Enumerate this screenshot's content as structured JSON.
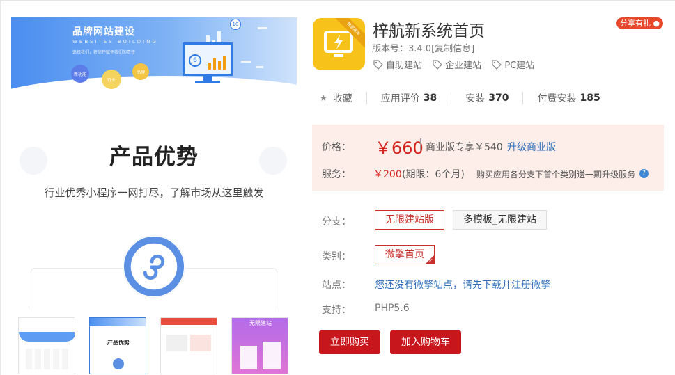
{
  "banner": {
    "title": "品牌网站建设",
    "subtitle": "WEBSITES BUILDING",
    "tagline": "选择我们，将信任赋予我们的责任",
    "bubble_1": "新功能",
    "bubble_2": "行业",
    "bubble_3": "品牌",
    "badge_number": "10",
    "screen_number": "6"
  },
  "slide": {
    "title": "产品优势",
    "subtitle": "行业优秀小程序一网打尽，了解市场从这里触发"
  },
  "thumbnails": [
    {
      "name": "thumb-1"
    },
    {
      "name": "thumb-2",
      "text": "产品优势"
    },
    {
      "name": "thumb-3"
    },
    {
      "name": "thumb-4",
      "text": "无限建站"
    }
  ],
  "app": {
    "icon_ribbon": "独家版本",
    "title": "梓航新系统首页",
    "share": "分享有礼",
    "version": "版本号：3.4.0[复制信息]",
    "tags": [
      "自助建站",
      "企业建站",
      "PC建站"
    ]
  },
  "stats": {
    "favorite": "收藏",
    "rating_label": "应用评价",
    "rating_count": "38",
    "install_label": "安装",
    "install_count": "370",
    "paid_label": "付费安装",
    "paid_count": "185"
  },
  "pricing": {
    "price_label": "价格：",
    "price": "￥660",
    "business_note": "商业版专享￥540",
    "upgrade_link": "升级商业版",
    "service_label": "服务：",
    "service_price": "￥200",
    "service_period": "(期限：6个月)",
    "service_note": "购买应用各分支下首个类别送一期升级服务",
    "help": "?"
  },
  "options": {
    "branch_label": "分支：",
    "branches": [
      "无限建站版",
      "多模板_无限建站"
    ],
    "category_label": "类别：",
    "categories": [
      "微擎首页"
    ],
    "site_label": "站点：",
    "site_text": "您还没有微擎站点，请先下载并注册微擎",
    "support_label": "支持：",
    "support_text": "PHP5.6"
  },
  "actions": {
    "buy_now": "立即购买",
    "add_cart": "加入购物车"
  },
  "colors": {
    "accent_red": "#c8161d",
    "price_bg": "#fdeee9",
    "link_blue": "#2f6fba",
    "icon_yellow": "#f7c21a"
  }
}
